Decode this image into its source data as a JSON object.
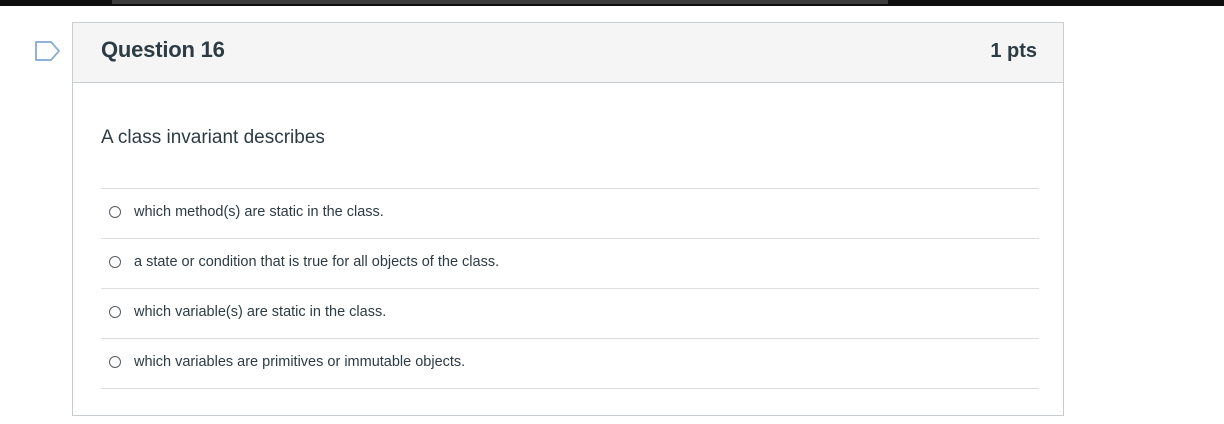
{
  "question": {
    "title": "Question 16",
    "points": "1 pts",
    "text": "A class invariant describes",
    "flag_icon": "bookmark-flag-icon",
    "answers": [
      {
        "label": "which method(s) are static in the class.",
        "selected": false
      },
      {
        "label": "a state or condition that is true for all objects of the class.",
        "selected": false
      },
      {
        "label": "which variable(s) are static in the class.",
        "selected": false
      },
      {
        "label": "which variables are primitives or immutable objects.",
        "selected": false
      }
    ]
  },
  "colors": {
    "header_bg": "#f5f5f5",
    "border": "#c7cdd1",
    "text": "#2d3b45",
    "flag": "#8fb1d9"
  }
}
